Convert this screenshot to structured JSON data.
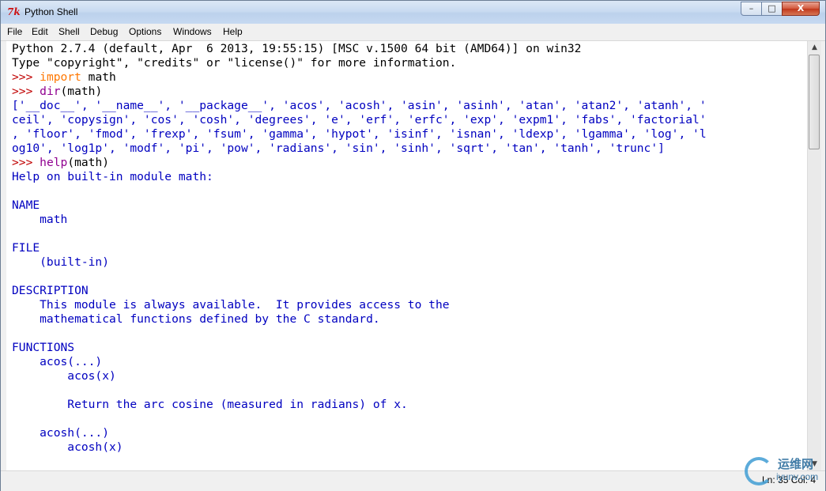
{
  "window": {
    "title": "Python Shell",
    "icon": "tk-icon"
  },
  "window_controls": {
    "minimize": "–",
    "maximize": "□",
    "close": "X"
  },
  "menubar": [
    "File",
    "Edit",
    "Shell",
    "Debug",
    "Options",
    "Windows",
    "Help"
  ],
  "shell": {
    "lines": [
      [
        {
          "t": "Python 2.7.4 (default, Apr  6 2013, 19:55:15) [MSC v.1500 64 bit (AMD64)] on win32",
          "c": "black"
        }
      ],
      [
        {
          "t": "Type \"copyright\", \"credits\" or \"license()\" for more information.",
          "c": "black"
        }
      ],
      [
        {
          "t": ">>> ",
          "c": "red"
        },
        {
          "t": "import",
          "c": "orange"
        },
        {
          "t": " math",
          "c": "black"
        }
      ],
      [
        {
          "t": ">>> ",
          "c": "red"
        },
        {
          "t": "dir",
          "c": "purple"
        },
        {
          "t": "(math)",
          "c": "black"
        }
      ],
      [
        {
          "t": "['__doc__', '__name__', '__package__', 'acos', 'acosh', 'asin', 'asinh', 'atan', 'atan2', 'atanh', '",
          "c": "blue"
        }
      ],
      [
        {
          "t": "ceil', 'copysign', 'cos', 'cosh', 'degrees', 'e', 'erf', 'erfc', 'exp', 'expm1', 'fabs', 'factorial'",
          "c": "blue"
        }
      ],
      [
        {
          "t": ", 'floor', 'fmod', 'frexp', 'fsum', 'gamma', 'hypot', 'isinf', 'isnan', 'ldexp', 'lgamma', 'log', 'l",
          "c": "blue"
        }
      ],
      [
        {
          "t": "og10', 'log1p', 'modf', 'pi', 'pow', 'radians', 'sin', 'sinh', 'sqrt', 'tan', 'tanh', 'trunc']",
          "c": "blue"
        }
      ],
      [
        {
          "t": ">>> ",
          "c": "red"
        },
        {
          "t": "help",
          "c": "purple"
        },
        {
          "t": "(math)",
          "c": "black"
        }
      ],
      [
        {
          "t": "Help on built-in module math:",
          "c": "blue"
        }
      ],
      [
        {
          "t": "",
          "c": "blue"
        }
      ],
      [
        {
          "t": "NAME",
          "c": "blue"
        }
      ],
      [
        {
          "t": "    math",
          "c": "blue"
        }
      ],
      [
        {
          "t": "",
          "c": "blue"
        }
      ],
      [
        {
          "t": "FILE",
          "c": "blue"
        }
      ],
      [
        {
          "t": "    (built-in)",
          "c": "blue"
        }
      ],
      [
        {
          "t": "",
          "c": "blue"
        }
      ],
      [
        {
          "t": "DESCRIPTION",
          "c": "blue"
        }
      ],
      [
        {
          "t": "    This module is always available.  It provides access to the",
          "c": "blue"
        }
      ],
      [
        {
          "t": "    mathematical functions defined by the C standard.",
          "c": "blue"
        }
      ],
      [
        {
          "t": "",
          "c": "blue"
        }
      ],
      [
        {
          "t": "FUNCTIONS",
          "c": "blue"
        }
      ],
      [
        {
          "t": "    acos(...)",
          "c": "blue"
        }
      ],
      [
        {
          "t": "        acos(x)",
          "c": "blue"
        }
      ],
      [
        {
          "t": "",
          "c": "blue"
        }
      ],
      [
        {
          "t": "        Return the arc cosine (measured in radians) of x.",
          "c": "blue"
        }
      ],
      [
        {
          "t": "",
          "c": "blue"
        }
      ],
      [
        {
          "t": "    acosh(...)",
          "c": "blue"
        }
      ],
      [
        {
          "t": "        acosh(x)",
          "c": "blue"
        }
      ]
    ]
  },
  "status": {
    "position": "Ln: 35 Col: 4"
  },
  "watermark": {
    "cn": "运维网",
    "en": "iyunv.com"
  },
  "colors": {
    "black": "#000000",
    "blue": "#0000c0",
    "red": "#c00000",
    "orange": "#ff7700",
    "purple": "#900090"
  }
}
